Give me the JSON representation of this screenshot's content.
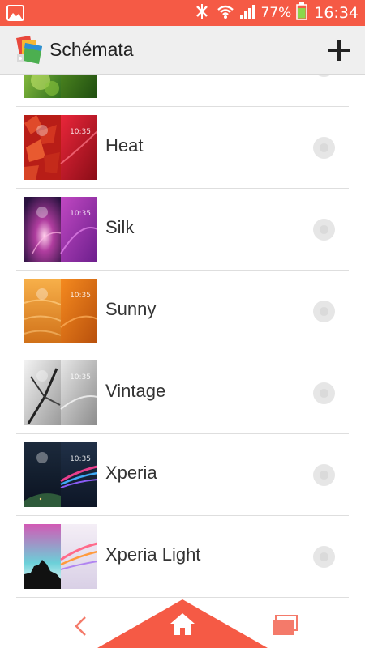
{
  "status_bar": {
    "battery_text": "77%",
    "time": "16:34",
    "icons": [
      "gallery-notification-icon",
      "bluetooth-nfc-icon",
      "wifi-icon",
      "signal-icon",
      "battery-icon"
    ]
  },
  "action_bar": {
    "title": "Schémata",
    "add_icon": "plus-icon"
  },
  "themes": [
    {
      "name": "",
      "selected": false,
      "thumb_time": ""
    },
    {
      "name": "Heat",
      "selected": false,
      "thumb_time": "10:35"
    },
    {
      "name": "Silk",
      "selected": false,
      "thumb_time": "10:35"
    },
    {
      "name": "Sunny",
      "selected": false,
      "thumb_time": "10:35"
    },
    {
      "name": "Vintage",
      "selected": false,
      "thumb_time": "10:35"
    },
    {
      "name": "Xperia",
      "selected": false,
      "thumb_time": "10:35"
    },
    {
      "name": "Xperia Light",
      "selected": false,
      "thumb_time": ""
    }
  ],
  "nav_bar": {
    "icons": [
      "back-icon",
      "home-icon",
      "recent-apps-icon"
    ]
  },
  "colors": {
    "accent": "#f55a45",
    "action_bar_bg": "#efefef"
  }
}
